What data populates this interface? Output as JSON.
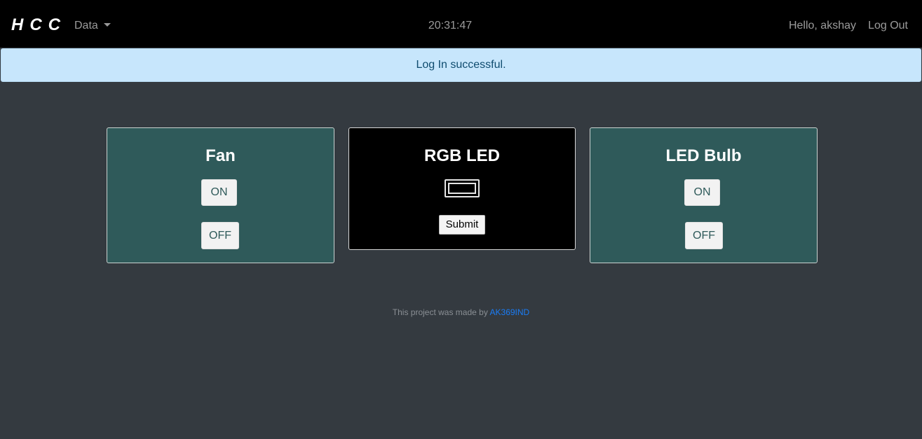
{
  "navbar": {
    "brand": "HCC",
    "data_menu_label": "Data",
    "clock": "20:31:47",
    "greeting": "Hello, akshay",
    "logout_label": "Log Out"
  },
  "alert": {
    "message": "Log In successful."
  },
  "devices": {
    "fan": {
      "title": "Fan",
      "on_label": "ON",
      "off_label": "OFF"
    },
    "rgb_led": {
      "title": "RGB LED",
      "submit_label": "Submit",
      "color_value": "#000000"
    },
    "led_bulb": {
      "title": "LED Bulb",
      "on_label": "ON",
      "off_label": "OFF"
    }
  },
  "footer": {
    "text": "This project was made by ",
    "link_text": "AK369IND"
  },
  "colors": {
    "navbar_bg": "#000000",
    "page_bg": "#343a40",
    "alert_bg": "#c7e6fc",
    "card_bg": "#2f5a5a",
    "link": "#1a7cf5"
  }
}
